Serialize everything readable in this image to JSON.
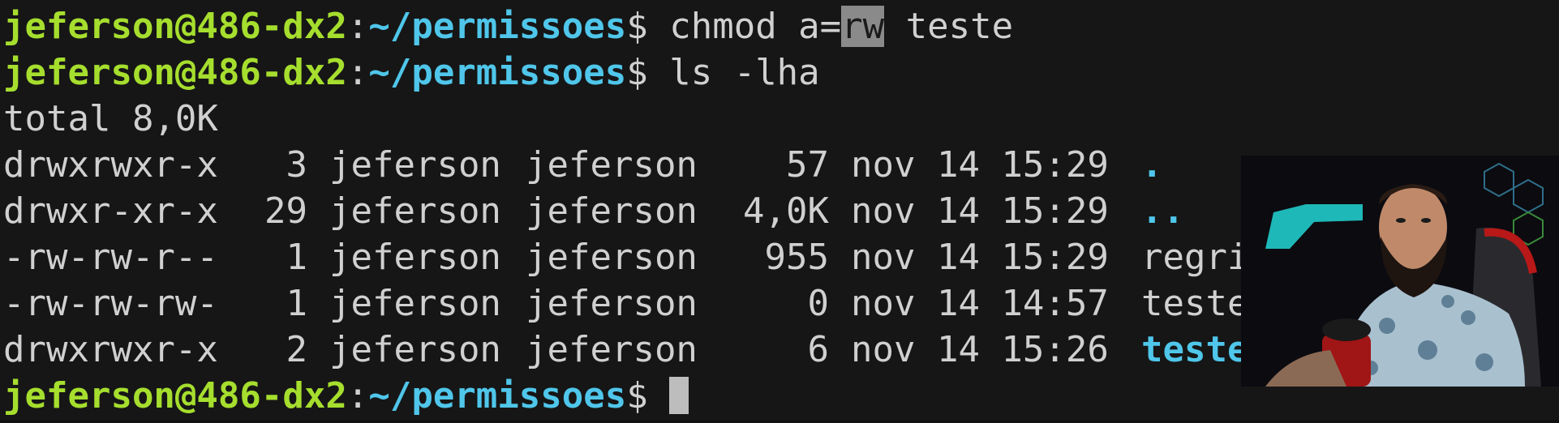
{
  "terminal": {
    "prompt": {
      "user_host": "jeferson@486-dx2",
      "separator": ":",
      "path": "~/permissoes",
      "symbol": "$"
    },
    "command1": {
      "before": "chmod a=",
      "highlighted": "rw",
      "after": " teste"
    },
    "command2": "ls -lha",
    "total_line": "total 8,0K",
    "listing": [
      {
        "perms": "drwxrwxr-x",
        "links": "3",
        "owner": "jeferson",
        "group": "jeferson",
        "size": "57",
        "date": "nov 14 15:29",
        "name": ".",
        "is_dir": true
      },
      {
        "perms": "drwxr-xr-x",
        "links": "29",
        "owner": "jeferson",
        "group": "jeferson",
        "size": "4,0K",
        "date": "nov 14 15:29",
        "name": "..",
        "is_dir": true
      },
      {
        "perms": "-rw-rw-r--",
        "links": "1",
        "owner": "jeferson",
        "group": "jeferson",
        "size": "955",
        "date": "nov 14 15:29",
        "name": "regrinha",
        "is_dir": false
      },
      {
        "perms": "-rw-rw-rw-",
        "links": "1",
        "owner": "jeferson",
        "group": "jeferson",
        "size": "0",
        "date": "nov 14 14:57",
        "name": "teste",
        "is_dir": false
      },
      {
        "perms": "drwxrwxr-x",
        "links": "2",
        "owner": "jeferson",
        "group": "jeferson",
        "size": "6",
        "date": "nov 14 15:26",
        "name": "teste_di",
        "is_dir": true
      }
    ]
  },
  "colors": {
    "background": "#161616",
    "prompt_user": "#a6de2e",
    "prompt_path": "#4fc6ea",
    "text": "#d0d0d0",
    "directory": "#4fc6ea"
  },
  "webcam": {
    "icon": "presenter-webcam-feed"
  }
}
